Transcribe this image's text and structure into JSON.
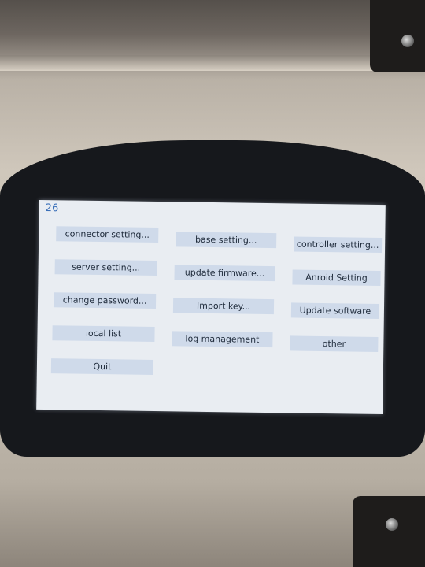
{
  "screen": {
    "number": "26",
    "buttons": [
      {
        "label": "connector setting..."
      },
      {
        "label": "base setting..."
      },
      {
        "label": "controller setting..."
      },
      {
        "label": "server setting..."
      },
      {
        "label": "update firmware..."
      },
      {
        "label": "Anroid Setting"
      },
      {
        "label": "change password..."
      },
      {
        "label": "Import key..."
      },
      {
        "label": "Update software"
      },
      {
        "label": "local list"
      },
      {
        "label": "log management"
      },
      {
        "label": "other"
      },
      {
        "label": "Quit"
      }
    ]
  }
}
